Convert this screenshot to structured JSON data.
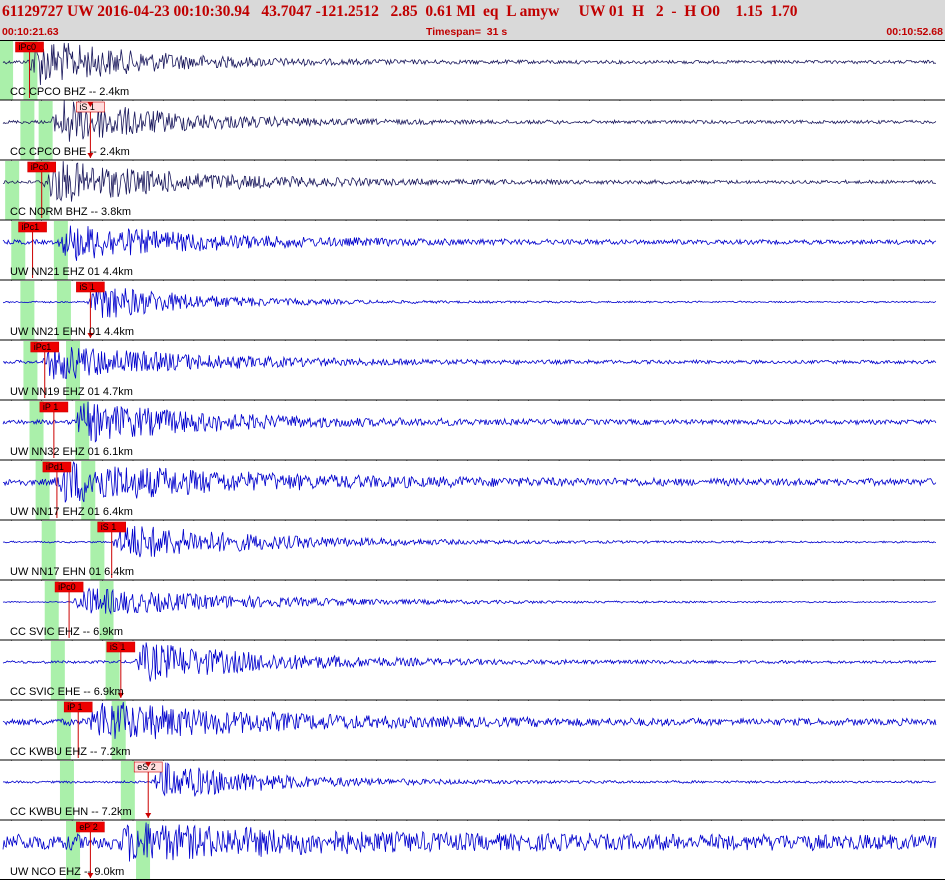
{
  "header": {
    "title": "61129727 UW 2016-04-23 00:10:30.94   43.7047 -121.2512   2.85  0.61 Ml  eq  L amyw     UW 01  H   2  -  H O0    1.15  1.70",
    "start_time": "00:10:21.63",
    "timespan": "Timespan=  31 s",
    "end_time": "00:10:52.68"
  },
  "colors": {
    "header_bg": "#d9d9d9",
    "header_text": "#c00000",
    "trace_dark": "#1c1a5e",
    "trace_blue": "#0000cc",
    "pick_line": "#cc0000",
    "pick_fill_strong": "#ee0000",
    "pick_fill_light": "#ffdddd",
    "window_green": "#aaf0aa"
  },
  "chart_data": {
    "type": "line",
    "description_free": true,
    "x_range_s": [
      21.63,
      52.68
    ],
    "traces": [
      {
        "label": "CC CPCO BHZ -- 2.4km",
        "color": "dark",
        "onset": 22.5,
        "noise": 0.06,
        "amp": 1.0,
        "decay": 8,
        "picks": [
          {
            "label": "iPc0",
            "t": 22.6,
            "style": "strong",
            "marker": "up"
          }
        ],
        "window": [
          21.6,
          22.4
        ]
      },
      {
        "label": "CC CPCO BHE -- 2.4km",
        "color": "dark",
        "onset": 23.3,
        "noise": 0.06,
        "amp": 1.0,
        "decay": 8,
        "picks": [
          {
            "label": "iS 1",
            "t": 24.6,
            "style": "light",
            "marker": "down"
          }
        ],
        "window": [
          22.3,
          22.9
        ]
      },
      {
        "label": "CC NORM BHZ -- 3.8km",
        "color": "dark",
        "onset": 23.0,
        "noise": 0.06,
        "amp": 0.9,
        "decay": 10,
        "picks": [
          {
            "label": "iPc0",
            "t": 23.0,
            "style": "strong",
            "marker": "up"
          }
        ],
        "window": [
          21.8,
          22.8
        ]
      },
      {
        "label": "UW NN21 EHZ 01 4.4km",
        "color": "blue",
        "onset": 23.5,
        "noise": 0.08,
        "amp": 0.75,
        "decay": 10,
        "picks": [
          {
            "label": "iPc1",
            "t": 22.7,
            "style": "strong",
            "marker": "up"
          }
        ],
        "window": [
          22.0,
          23.4
        ]
      },
      {
        "label": "UW NN21 EHN 01 4.4km",
        "color": "blue",
        "onset": 24.5,
        "noise": 0.03,
        "amp": 0.8,
        "decay": 7,
        "picks": [
          {
            "label": "iS 1",
            "t": 24.6,
            "style": "strong",
            "marker": "down"
          }
        ],
        "window": [
          22.3,
          23.5
        ]
      },
      {
        "label": "UW NN19 EHZ 01 4.7km",
        "color": "blue",
        "onset": 23.0,
        "noise": 0.06,
        "amp": 0.75,
        "decay": 10,
        "picks": [
          {
            "label": "iPc1",
            "t": 23.1,
            "style": "strong",
            "marker": "up"
          }
        ],
        "window": [
          22.4,
          23.8
        ]
      },
      {
        "label": "UW NN32 EHZ 01 6.1km",
        "color": "blue",
        "onset": 24.0,
        "noise": 0.08,
        "amp": 0.8,
        "decay": 10,
        "picks": [
          {
            "label": "iP 1",
            "t": 23.4,
            "style": "strong",
            "marker": "up"
          }
        ],
        "window": [
          22.6,
          24.1
        ]
      },
      {
        "label": "UW NN17 EHZ 01 6.4km",
        "color": "blue",
        "onset": 23.4,
        "noise": 0.12,
        "amp": 0.85,
        "decay": 12,
        "picks": [
          {
            "label": "iPd1",
            "t": 23.5,
            "style": "strong",
            "marker": "up"
          }
        ],
        "window": [
          22.8,
          24.3
        ]
      },
      {
        "label": "UW NN17 EHN 01 6.4km",
        "color": "blue",
        "onset": 25.3,
        "noise": 0.03,
        "amp": 0.8,
        "decay": 10,
        "picks": [
          {
            "label": "iS 1",
            "t": 25.3,
            "style": "strong",
            "marker": "up"
          }
        ],
        "window": [
          23.0,
          24.6
        ]
      },
      {
        "label": "CC SVIC EHZ -- 6.9km",
        "color": "blue",
        "onset": 24.0,
        "noise": 0.02,
        "amp": 0.6,
        "decay": 12,
        "picks": [
          {
            "label": "iPc0",
            "t": 23.9,
            "style": "strong",
            "marker": "up"
          }
        ],
        "window": [
          23.1,
          24.9
        ]
      },
      {
        "label": "CC SVIC EHE -- 6.9km",
        "color": "blue",
        "onset": 26.0,
        "noise": 0.05,
        "amp": 0.8,
        "decay": 10,
        "picks": [
          {
            "label": "iS 1",
            "t": 25.6,
            "style": "strong",
            "marker": "down"
          }
        ],
        "window": [
          23.3,
          25.1
        ]
      },
      {
        "label": "CC KWBU EHZ -- 7.2km",
        "color": "blue",
        "onset": 24.5,
        "noise": 0.12,
        "amp": 0.8,
        "decay": 12,
        "picks": [
          {
            "label": "iP 1",
            "t": 24.2,
            "style": "strong",
            "marker": "up"
          }
        ],
        "window": [
          23.5,
          25.3
        ]
      },
      {
        "label": "CC KWBU EHN -- 7.2km",
        "color": "blue",
        "onset": 26.6,
        "noise": 0.04,
        "amp": 0.8,
        "decay": 8,
        "picks": [
          {
            "label": "eS 2",
            "t": 26.5,
            "style": "light",
            "marker": "down"
          }
        ],
        "window": [
          23.6,
          25.6
        ]
      },
      {
        "label": "UW NCO EHZ -- 9.0km",
        "color": "blue",
        "onset": 25.5,
        "noise": 0.28,
        "amp": 0.6,
        "decay": 12,
        "picks": [
          {
            "label": "eP 2",
            "t": 24.6,
            "style": "strong",
            "marker": "down"
          }
        ],
        "window": [
          23.8,
          26.1
        ]
      }
    ]
  }
}
